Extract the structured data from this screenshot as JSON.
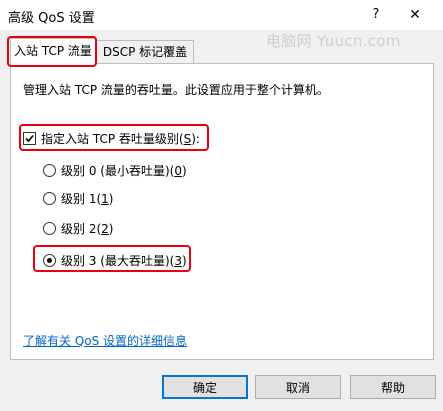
{
  "window": {
    "title": "高级 QoS 设置",
    "help_label": "?",
    "close_label": "✕"
  },
  "watermark": "电脑网 Yuucn.com",
  "tabs": [
    {
      "label": "入站 TCP 流量",
      "active": true
    },
    {
      "label": "DSCP 标记覆盖",
      "active": false
    }
  ],
  "panel": {
    "description": "管理入站 TCP 流量的吞吐量。此设置应用于整个计算机。",
    "checkbox": {
      "label_prefix": "指定入站 TCP 吞吐量级别(",
      "label_key": "S",
      "label_suffix": "):",
      "checked": true
    },
    "radios": [
      {
        "prefix": "级别 0 (最小吞吐量)(",
        "key": "0",
        "suffix": ")",
        "selected": false
      },
      {
        "prefix": "级别 1(",
        "key": "1",
        "suffix": ")",
        "selected": false
      },
      {
        "prefix": "级别 2(",
        "key": "2",
        "suffix": ")",
        "selected": false
      },
      {
        "prefix": "级别 3 (最大吞吐量)(",
        "key": "3",
        "suffix": ")",
        "selected": true
      }
    ],
    "link": "了解有关 QoS 设置的详细信息"
  },
  "buttons": {
    "ok": "确定",
    "cancel": "取消",
    "help": "帮助"
  },
  "colors": {
    "highlight": "#e60012",
    "link": "#0066cc",
    "default_button_border": "#0078d7"
  }
}
